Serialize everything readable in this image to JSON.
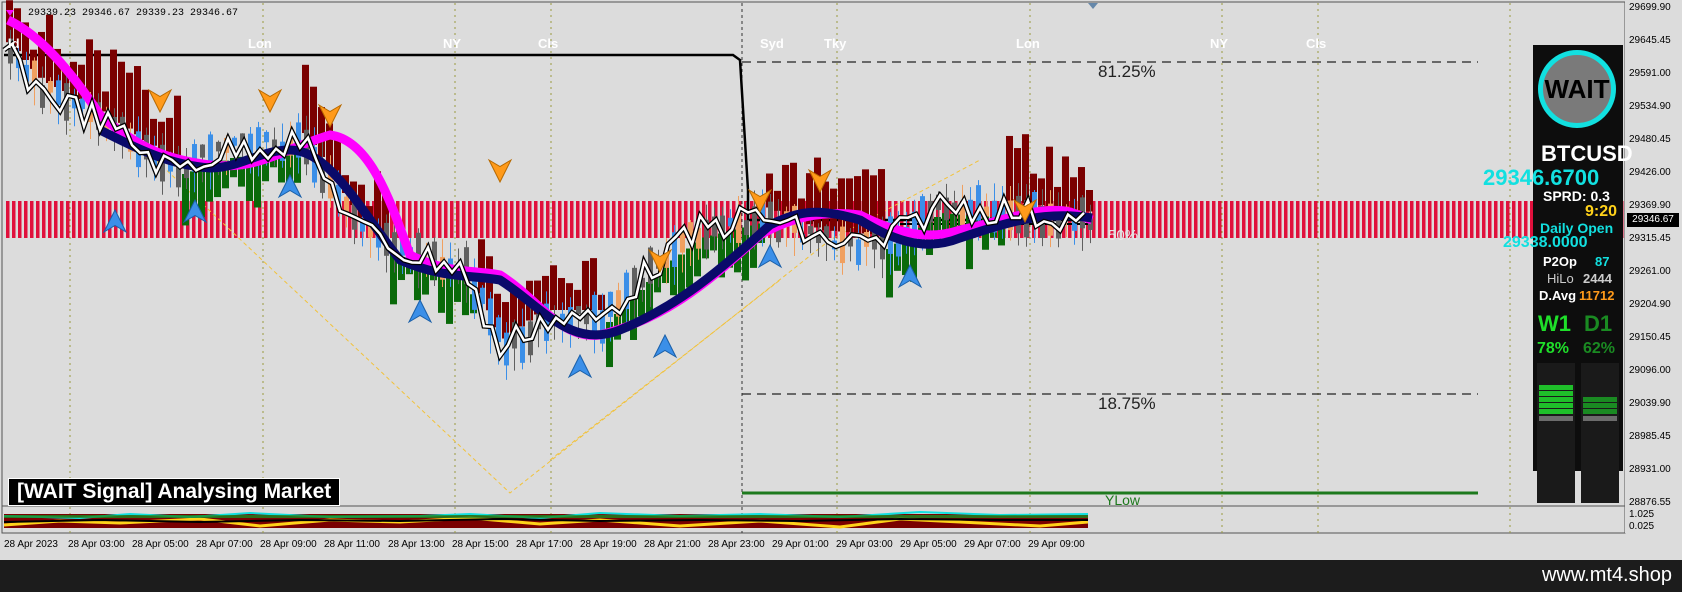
{
  "ohlc_readout": "29339.23 29346.67 29339.23 29346.67",
  "sessions": [
    "ld",
    "Lon",
    "NY",
    "Cls",
    "Syd",
    "Tky",
    "Lon",
    "NY",
    "Cls"
  ],
  "fib_levels": {
    "upper": "81.25%",
    "mid": "50%",
    "lower": "18.75%"
  },
  "ylow_label": "YLow",
  "signal_text": "[WAIT Signal] Analysing Market",
  "price_axis": [
    "29699.90",
    "29645.45",
    "29591.00",
    "29534.90",
    "29480.45",
    "29426.00",
    "29369.90",
    "29315.45",
    "29261.00",
    "29204.90",
    "29150.45",
    "29096.00",
    "29039.90",
    "28985.45",
    "28931.00",
    "28876.55"
  ],
  "current_price": "29346.67",
  "osc_axis": [
    "1.025",
    "0.025"
  ],
  "time_axis": [
    "28 Apr 2023",
    "28 Apr 03:00",
    "28 Apr 05:00",
    "28 Apr 07:00",
    "28 Apr 09:00",
    "28 Apr 11:00",
    "28 Apr 13:00",
    "28 Apr 15:00",
    "28 Apr 17:00",
    "28 Apr 19:00",
    "28 Apr 21:00",
    "28 Apr 23:00",
    "29 Apr 01:00",
    "29 Apr 03:00",
    "29 Apr 05:00",
    "29 Apr 07:00",
    "29 Apr 09:00"
  ],
  "panel": {
    "status": "WAIT",
    "symbol": "BTCUSD",
    "bid": "29346.6700",
    "spread": "SPRD: 0.3",
    "timer": "9:20",
    "daily_open_label": "Daily Open",
    "daily_open_value": "29338.0000",
    "p2op_label": "P2Op",
    "p2op_value": "87",
    "hilo_label": "HiLo",
    "hilo_value": "2444",
    "davg_label": "D.Avg",
    "davg_value": "11712",
    "w1_label": "W1",
    "d1_label": "D1",
    "w1_pct": "78%",
    "d1_pct": "62%"
  },
  "colors": {
    "cyan": "#12e0e0",
    "green": "#1fdf2a",
    "dark_green": "#1a8a22",
    "orange": "#ff9a1a",
    "magenta": "#ff00ff",
    "navy": "#0a0a6a",
    "maroon": "#7a0000"
  },
  "footer_site": "www.mt4.shop"
}
